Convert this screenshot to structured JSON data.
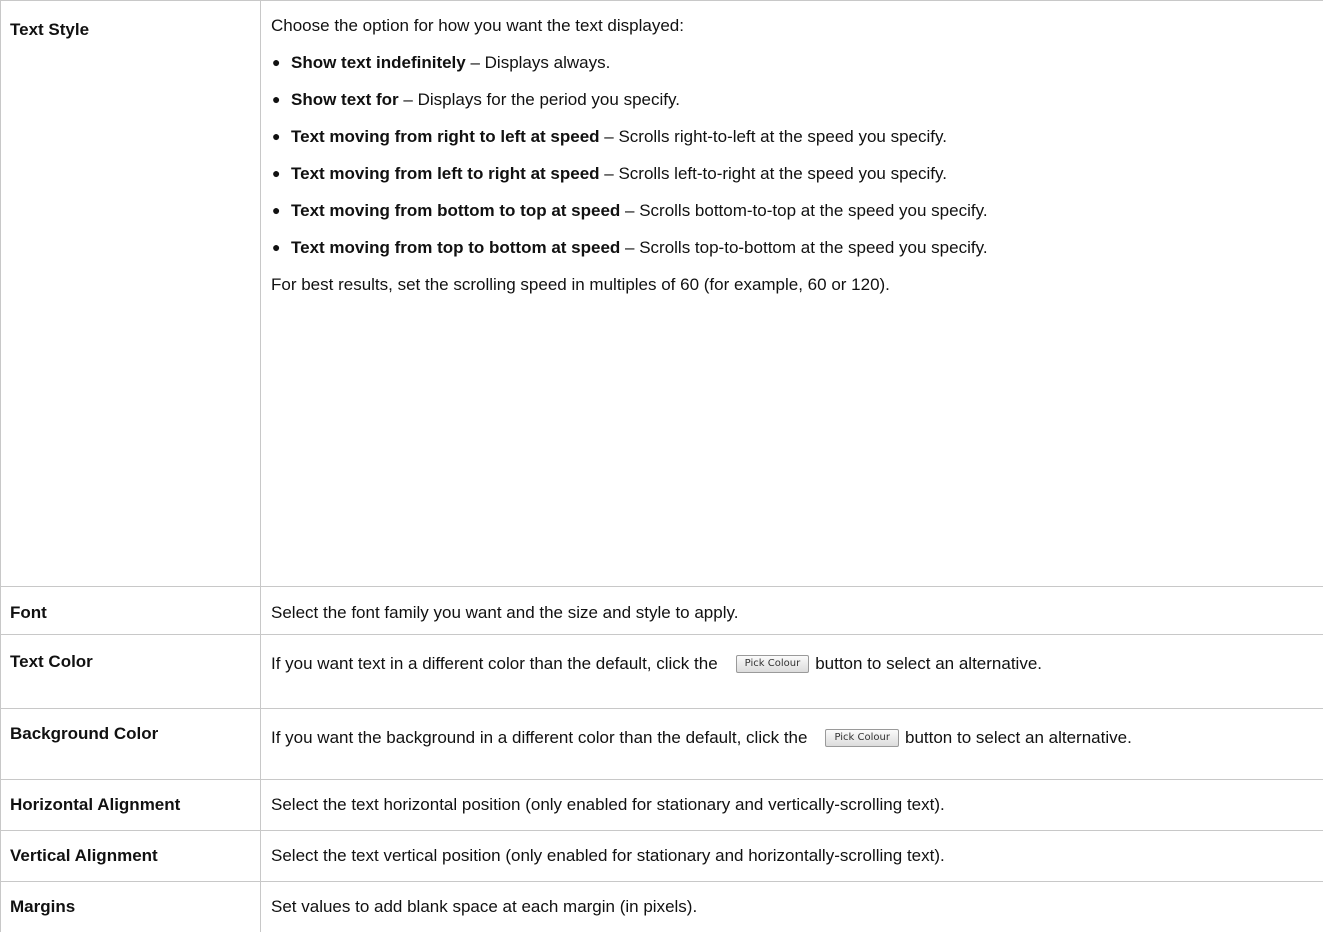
{
  "rows": [
    {
      "term": "Text Style",
      "intro": "Choose the option for how you want the text displayed:",
      "options": [
        {
          "bold": "Show text indefinitely",
          "rest": " – Displays always."
        },
        {
          "bold": "Show text for",
          "rest": " – Displays for the period you specify."
        },
        {
          "bold": "Text moving from right to left at speed",
          "rest": " – Scrolls right-to-left at the speed you specify."
        },
        {
          "bold": "Text moving from left to right at speed",
          "rest": " – Scrolls left-to-right at the speed you specify."
        },
        {
          "bold": "Text moving from bottom to top at speed",
          "rest": " – Scrolls bottom-to-top at the speed you specify."
        },
        {
          "bold": "Text moving from top to bottom at speed",
          "rest": " – Scrolls top-to-bottom at the speed you specify."
        }
      ],
      "footnote": "For best results, set the scrolling speed in multiples of 60 (for example, 60 or 120)."
    },
    {
      "term": "Font",
      "desc": "Select the font family you want and the size and style to apply."
    },
    {
      "term": "Text Color",
      "desc_before": "If you want text in a different color than the default, click the",
      "button": "Pick Colour",
      "desc_after": "button to select an alternative."
    },
    {
      "term": "Background Color",
      "desc_before": "If you want the background in a different color than the default, click the",
      "button": "Pick Colour",
      "desc_after": "button to select an alternative."
    },
    {
      "term": "Horizontal Alignment",
      "desc": "Select the text horizontal position (only enabled for stationary and vertically-scrolling text)."
    },
    {
      "term": "Vertical Alignment",
      "desc": "Select the text vertical position (only enabled for stationary and horizontally-scrolling text)."
    },
    {
      "term": "Margins",
      "desc": "Set values to add blank space at each margin (in pixels)."
    }
  ]
}
